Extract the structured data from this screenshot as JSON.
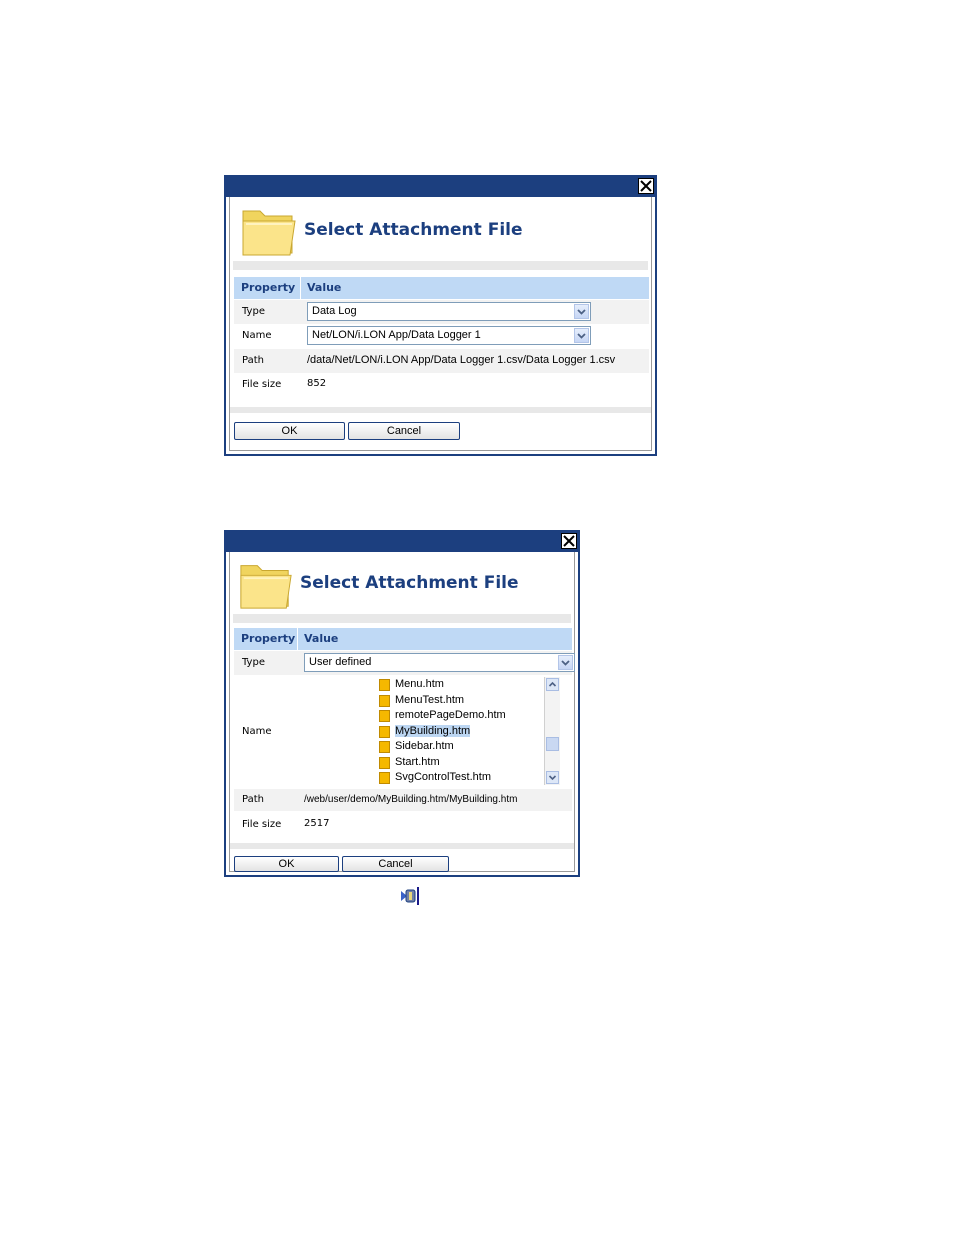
{
  "dialog1": {
    "title": "Select Attachment File",
    "headers": {
      "property": "Property",
      "value": "Value"
    },
    "type_label": "Type",
    "type_value": "Data Log",
    "name_label": "Name",
    "name_value": "Net/LON/i.LON App/Data Logger 1",
    "path_label": "Path",
    "path_value": "/data/Net/LON/i.LON App/Data Logger 1.csv/Data Logger 1.csv",
    "size_label": "File size",
    "size_value": "852",
    "ok_label": "OK",
    "cancel_label": "Cancel"
  },
  "dialog2": {
    "title": "Select Attachment File",
    "headers": {
      "property": "Property",
      "value": "Value"
    },
    "type_label": "Type",
    "type_value": "User defined",
    "name_label": "Name",
    "files": [
      "Menu.htm",
      "MenuTest.htm",
      "remotePageDemo.htm",
      "MyBuilding.htm",
      "Sidebar.htm",
      "Start.htm",
      "SvgControlTest.htm"
    ],
    "selected_file": "MyBuilding.htm",
    "path_label": "Path",
    "path_value": "/web/user/demo/MyBuilding.htm/MyBuilding.htm",
    "size_label": "File size",
    "size_value": "2517",
    "ok_label": "OK",
    "cancel_label": "Cancel"
  },
  "icons": {
    "close": "close-icon",
    "folder": "folder-icon",
    "dropdown": "chevron-down-icon",
    "file": "file-icon",
    "attachment": "attachment-icon"
  },
  "colors": {
    "titlebar": "#1c3f7f",
    "header_row": "#bfd9f5",
    "title_text": "#1c3f7f",
    "selection": "#bcd6f2"
  }
}
